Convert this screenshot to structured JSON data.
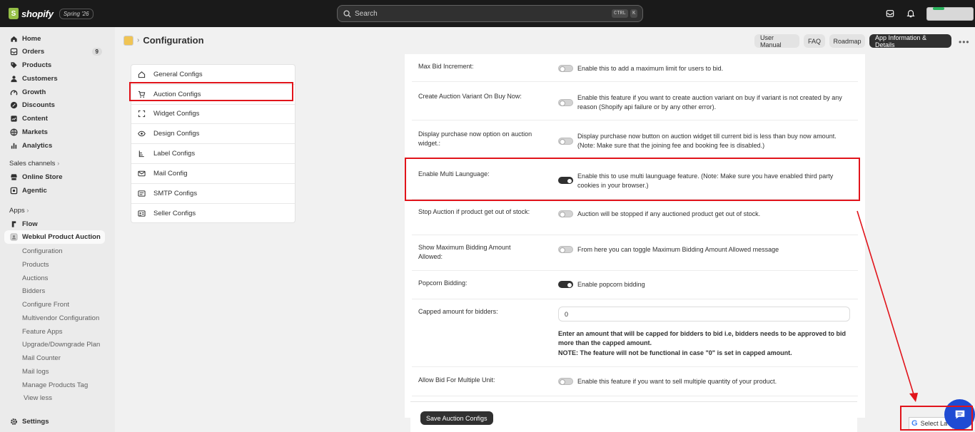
{
  "topbar": {
    "brand": "shopify",
    "badge": "Spring '26",
    "search_placeholder": "Search",
    "kbd_ctrl": "CTRL",
    "kbd_k": "K"
  },
  "sidebar": {
    "main": [
      {
        "label": "Home",
        "icon": "home-icon"
      },
      {
        "label": "Orders",
        "icon": "orders-icon",
        "count": "9"
      },
      {
        "label": "Products",
        "icon": "tag-icon"
      },
      {
        "label": "Customers",
        "icon": "person-icon"
      },
      {
        "label": "Growth",
        "icon": "growth-icon"
      },
      {
        "label": "Discounts",
        "icon": "discount-icon"
      },
      {
        "label": "Content",
        "icon": "content-icon"
      },
      {
        "label": "Markets",
        "icon": "globe-icon"
      },
      {
        "label": "Analytics",
        "icon": "analytics-icon"
      }
    ],
    "sales_channels_label": "Sales channels",
    "channels": [
      {
        "label": "Online Store",
        "icon": "store-icon"
      },
      {
        "label": "Agentic",
        "icon": "agentic-icon"
      }
    ],
    "apps_label": "Apps",
    "apps": [
      {
        "label": "Flow",
        "icon": "flow-icon"
      },
      {
        "label": "Webkul Product Auction",
        "icon": "app-icon"
      }
    ],
    "app_subitems": [
      "Configuration",
      "Products",
      "Auctions",
      "Bidders",
      "Configure Front",
      "Multivendor Configuration",
      "Feature Apps",
      "Upgrade/Downgrade Plan",
      "Mail Counter",
      "Mail logs",
      "Manage Products Tag"
    ],
    "view_less": "View less",
    "settings": "Settings"
  },
  "header": {
    "title": "Configuration",
    "buttons": [
      "User Manual",
      "FAQ",
      "Roadmap",
      "App Information & Details"
    ],
    "more": "•••"
  },
  "config_menu": [
    {
      "label": "General Configs",
      "icon": "home-icon"
    },
    {
      "label": "Auction Configs",
      "icon": "cart-icon"
    },
    {
      "label": "Widget Configs",
      "icon": "widget-icon"
    },
    {
      "label": "Design Configs",
      "icon": "eye-icon"
    },
    {
      "label": "Label Configs",
      "icon": "label-icon"
    },
    {
      "label": "Mail Config",
      "icon": "mail-icon"
    },
    {
      "label": "SMTP Configs",
      "icon": "smtp-icon"
    },
    {
      "label": "Seller Configs",
      "icon": "seller-icon"
    }
  ],
  "settings_rows": [
    {
      "label": "Max Bid Increment:",
      "on": false,
      "desc": "Enable this to add a maximum limit for users to bid."
    },
    {
      "label": "Create Auction Variant On Buy Now:",
      "on": false,
      "desc": "Enable this feature if you want to create auction variant on buy if variant is not created by any reason (Shopify api failure or by any other error)."
    },
    {
      "label": "Display purchase now option on auction widget.:",
      "on": false,
      "desc": "Display purchase now button on auction widget till current bid is less than buy now amount. (Note: Make sure that the joining fee and booking fee is disabled.)"
    },
    {
      "label": "Enable Multi Launguage:",
      "on": true,
      "desc": "Enable this to use multi launguage feature. (Note: Make sure you have enabled third party cookies in your browser.)"
    },
    {
      "label": "Stop Auction if product get out of stock:",
      "on": false,
      "desc": "Auction will be stopped if any auctioned product get out of stock."
    },
    {
      "label": "Show Maximum Bidding Amount Allowed:",
      "on": false,
      "desc": "From here you can toggle Maximum Bidding Amount Allowed message"
    },
    {
      "label": "Popcorn Bidding:",
      "on": true,
      "desc": "Enable popcorn bidding"
    }
  ],
  "capped": {
    "label": "Capped amount for bidders:",
    "value": "0",
    "note1": "Enter an amount that will be capped for bidders to bid i.e, bidders needs to be approved to bid more than the capped amount.",
    "note2": "NOTE: The feature will not be functional in case \"0\" is set in capped amount."
  },
  "multi_unit": {
    "label": "Allow Bid For Multiple Unit:",
    "on": false,
    "desc": "Enable this feature if you want to sell multiple quantity of your product."
  },
  "save_label": "Save Auction Configs",
  "language_widget": {
    "g": "G",
    "label": "Select La"
  },
  "colors": {
    "accent_red": "#e1141b",
    "chat_blue": "#1f4bd3",
    "dark": "#303030"
  }
}
